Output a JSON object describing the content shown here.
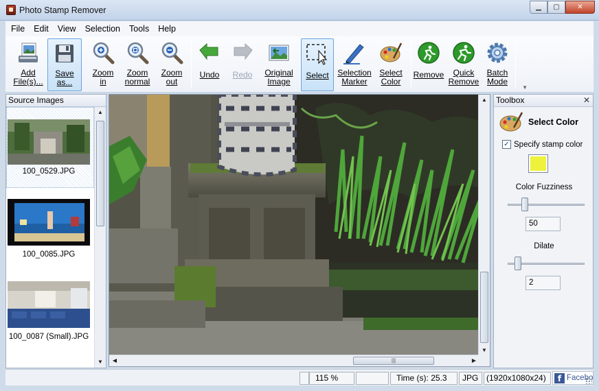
{
  "window": {
    "title": "Photo Stamp Remover"
  },
  "menu": {
    "items": [
      "File",
      "Edit",
      "View",
      "Selection",
      "Tools",
      "Help"
    ]
  },
  "toolbar": {
    "add_files": "Add File(s)...",
    "save_as": "Save as...",
    "zoom_in": "Zoom in",
    "zoom_normal": "Zoom normal",
    "zoom_out": "Zoom out",
    "undo": "Undo",
    "redo": "Redo",
    "original_image": "Original Image",
    "select": "Select",
    "selection_marker": "Selection Marker",
    "select_color": "Select Color",
    "remove": "Remove",
    "quick_remove": "Quick Remove",
    "batch_mode": "Batch Mode"
  },
  "source_images": {
    "header": "Source Images",
    "items": [
      {
        "name": "100_0529.JPG",
        "selected": true
      },
      {
        "name": "100_0085.JPG",
        "selected": false
      },
      {
        "name": "100_0087 (Small).JPG",
        "selected": false
      }
    ]
  },
  "toolbox": {
    "header": "Toolbox",
    "title": "Select Color",
    "specify_stamp_color": "Specify stamp color",
    "specify_checked": true,
    "stamp_color": "#eef23b",
    "fuzziness_label": "Color Fuzziness",
    "fuzziness_value": "50",
    "dilate_label": "Dilate",
    "dilate_value": "2"
  },
  "status": {
    "zoom": "115 %",
    "time": "Time (s): 25.3",
    "format": "JPG",
    "size": "(1920x1080x24)",
    "facebook": "Facebook"
  },
  "colors": {
    "accent": "#6aa3dc",
    "selection": "#c9e2f8"
  }
}
